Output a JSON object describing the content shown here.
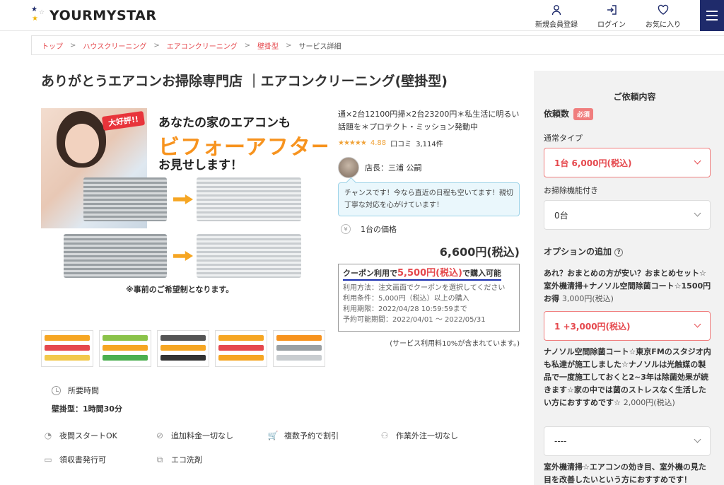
{
  "header": {
    "logo_text": "YOURMYSTAR",
    "nav": [
      {
        "label": "新規会員登録",
        "icon": "user-icon"
      },
      {
        "label": "ログイン",
        "icon": "login-icon"
      },
      {
        "label": "お気に入り",
        "icon": "heart-icon"
      }
    ],
    "menu_icon": "hamburger-icon"
  },
  "breadcrumb": {
    "items": [
      "トップ",
      "ハウスクリーニング",
      "エアコンクリーニング",
      "壁掛型"
    ],
    "sep": ">",
    "current": "サービス詳細"
  },
  "title": "ありがとうエアコンお掃除専門店 ｜エアコンクリーニング(壁掛型)",
  "hero": {
    "ribbon": "大好評!!",
    "line1": "あなたの家のエアコンも",
    "line2": "ビフォーアフター",
    "line3": "お見せします！",
    "note": "※事前のご希望制となります。"
  },
  "description": "通×2台12100円掃×2台23200円＊私生活に明るい話題を＊プロテクト・ミッション発動中",
  "rating": {
    "stars": "★★★★★",
    "score": "4.88",
    "review_label": "口コミ",
    "review_count": "3,114件"
  },
  "manager": "店長：三浦 公嗣",
  "bubble": "チャンスです！今なら直近の日程も空いてます！親切丁寧な対応を心がけています！",
  "unit_label": "1台の価格",
  "unit_icon": "yen-icon",
  "price": "6,600円(税込)",
  "coupon": {
    "prefix": "クーポン利用で",
    "amount": "5,500円(税込)",
    "suffix": "で購入可能",
    "method": "利用方法：注文画面でクーポンを選択してください",
    "condition": "利用条件：5,000円（税込）以上の購入",
    "expiry": "利用期限：2022/04/28 10:59:59まで",
    "period": "予約可能期間：2022/04/01 〜 2022/05/31"
  },
  "fee_note": "(サービス利用料10%が含まれています。)",
  "duration": {
    "label": "所要時間",
    "value": "壁掛型：1時間30分"
  },
  "features": [
    {
      "label": "夜間スタートOK",
      "icon": "moon-clock-icon"
    },
    {
      "label": "追加料金一切なし",
      "icon": "no-fee-icon"
    },
    {
      "label": "複数予約で割引",
      "icon": "cart-icon"
    },
    {
      "label": "作業外注一切なし",
      "icon": "people-icon"
    },
    {
      "label": "領収書発行可",
      "icon": "receipt-icon"
    },
    {
      "label": "エコ洗剤",
      "icon": "eco-icon"
    }
  ],
  "panel": {
    "title": "ご依頼内容",
    "count_label": "依頼数",
    "required": "必須",
    "normal_label": "通常タイプ",
    "normal_value": "1台 6,000円(税込)",
    "func_label": "お掃除機能付き",
    "func_value": "0台",
    "option_label": "オプションの追加",
    "option1_text": "あれ？おまとめの方が安い？おまとめセット☆室外機清掃+ナノソル空間除菌コート☆1500円お得",
    "option1_price": "3,000円(税込)",
    "option1_value": "1 +3,000円(税込)",
    "option2_text": "ナノソル空間除菌コート☆東京FMのスタジオ内も私達が施工しました☆ナノソルは光触媒の製品で一度施工しておくと2~3年は除菌効果が続きます☆家の中では菌のストレスなく生活したい方におすすめです☆",
    "option2_price": "2,000円(税込)",
    "option2_value": "----",
    "option3_text": "室外機清掃☆エアコンの効き目、室外機の見た目を改善したいという方におすすめです！"
  },
  "colors": {
    "accent": "#e5484d",
    "navy": "#1f2b6b",
    "star": "#f0a33a",
    "orange": "#f7931e"
  }
}
